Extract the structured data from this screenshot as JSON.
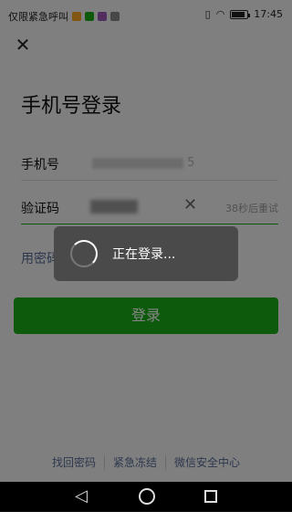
{
  "status_bar": {
    "carrier_text": "仅限紧急呼叫",
    "time": "17:45",
    "battery_level": 0.9,
    "app_icon_colors": [
      "#f5a623",
      "#1aad19",
      "#9b59b6",
      "#888888"
    ]
  },
  "page": {
    "close_icon": "close-icon",
    "title": "手机号登录",
    "phone_label": "手机号",
    "phone_value_visible": "5",
    "code_label": "验证码",
    "retry_text": "38秒后重试",
    "password_login_link": "用密码登录",
    "login_button": "登录"
  },
  "toast": {
    "text": "正在登录..."
  },
  "footer": {
    "links": [
      "找回密码",
      "紧急冻结",
      "微信安全中心"
    ]
  },
  "colors": {
    "accent": "#1aad19",
    "link": "#576b95"
  }
}
